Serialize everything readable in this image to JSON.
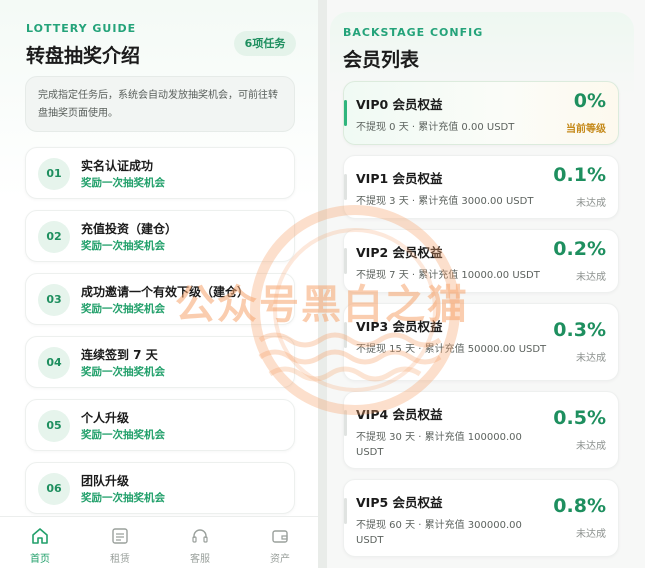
{
  "lottery": {
    "eyebrow": "LOTTERY GUIDE",
    "title": "转盘抽奖介绍",
    "badge": "6项任务",
    "notice": "完成指定任务后，系统会自动发放抽奖机会，可前往转盘抽奖页面使用。",
    "tasks": [
      {
        "num": "01",
        "name": "实名认证成功",
        "reward": "奖励一次抽奖机会"
      },
      {
        "num": "02",
        "name": "充值投资（建仓）",
        "reward": "奖励一次抽奖机会"
      },
      {
        "num": "03",
        "name": "成功邀请一个有效下级（建仓）",
        "reward": "奖励一次抽奖机会"
      },
      {
        "num": "04",
        "name": "连续签到 7 天",
        "reward": "奖励一次抽奖机会"
      },
      {
        "num": "05",
        "name": "个人升级",
        "reward": "奖励一次抽奖机会"
      },
      {
        "num": "06",
        "name": "团队升级",
        "reward": "奖励一次抽奖机会"
      }
    ]
  },
  "tabbar": {
    "items": [
      {
        "label": "首页",
        "icon": "home-icon",
        "active": true
      },
      {
        "label": "租赁",
        "icon": "lease-icon",
        "active": false
      },
      {
        "label": "客服",
        "icon": "headset-icon",
        "active": false
      },
      {
        "label": "资产",
        "icon": "wallet-icon",
        "active": false
      }
    ]
  },
  "members": {
    "eyebrow": "BACKSTAGE CONFIG",
    "title": "会员列表",
    "vips": [
      {
        "title": "VIP0 会员权益",
        "desc": "不提现 0 天 · 累计充值 0.00 USDT",
        "percent": "0%",
        "status": "当前等级"
      },
      {
        "title": "VIP1 会员权益",
        "desc": "不提现 3 天 · 累计充值 3000.00 USDT",
        "percent": "0.1%",
        "status": "未达成"
      },
      {
        "title": "VIP2 会员权益",
        "desc": "不提现 7 天 · 累计充值 10000.00 USDT",
        "percent": "0.2%",
        "status": "未达成"
      },
      {
        "title": "VIP3 会员权益",
        "desc": "不提现 15 天 · 累计充值 50000.00 USDT",
        "percent": "0.3%",
        "status": "未达成"
      },
      {
        "title": "VIP4 会员权益",
        "desc": "不提现 30 天 · 累计充值 100000.00 USDT",
        "percent": "0.5%",
        "status": "未达成"
      },
      {
        "title": "VIP5 会员权益",
        "desc": "不提现 60 天 · 累计充值 300000.00 USDT",
        "percent": "0.8%",
        "status": "未达成"
      }
    ]
  },
  "watermark": "公众号黑白之猫",
  "colors": {
    "accent": "#22a06b",
    "current_status": "#c58a1b",
    "watermark": "#f6a46e"
  }
}
